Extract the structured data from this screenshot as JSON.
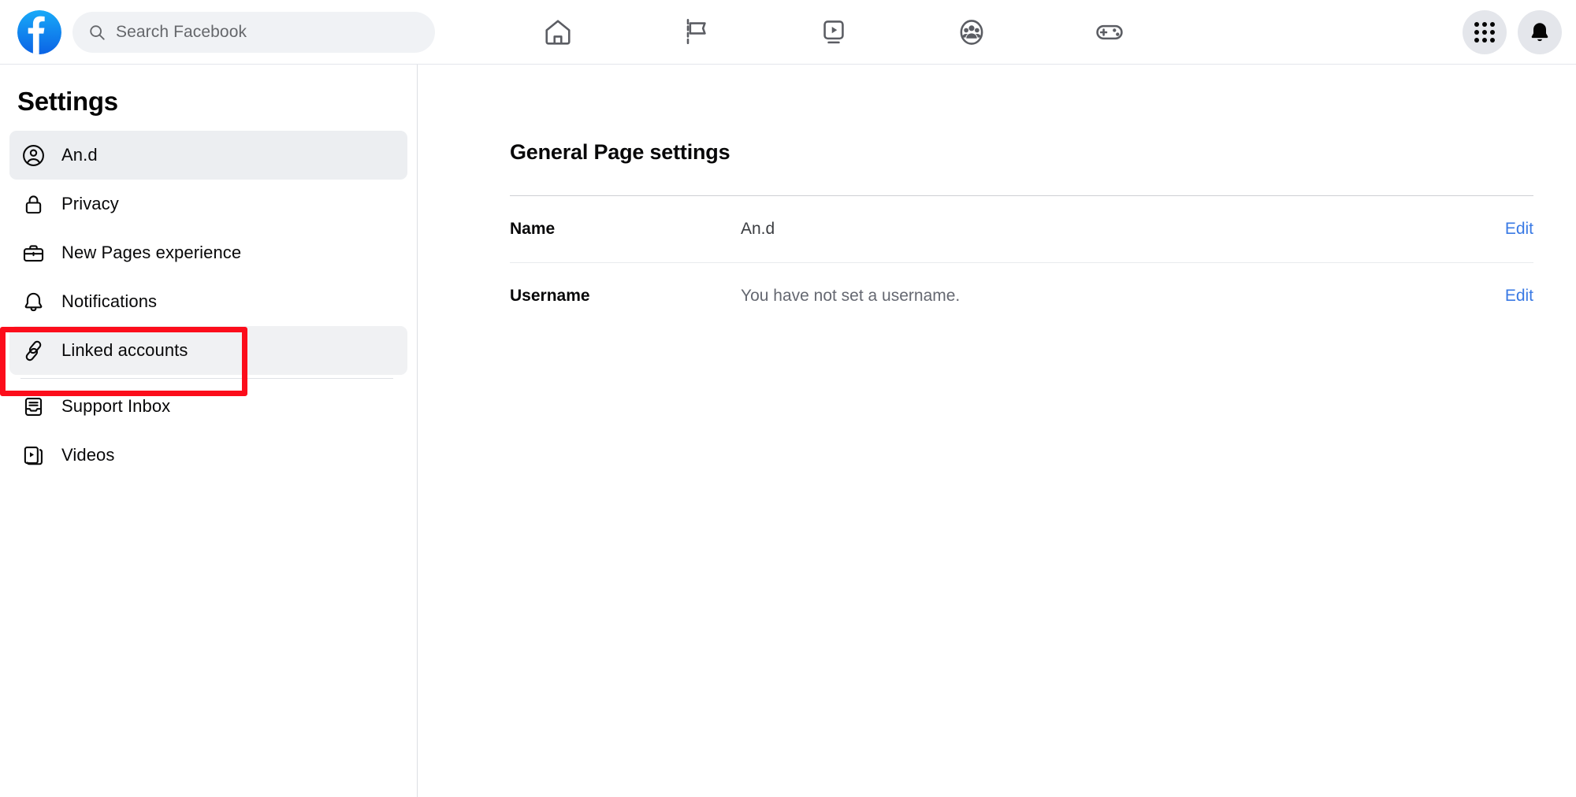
{
  "header": {
    "logo_icon": "facebook-logo",
    "search": {
      "placeholder": "Search Facebook",
      "value": "",
      "icon": "search-icon"
    },
    "nav_items": [
      {
        "name": "home",
        "icon": "home-icon"
      },
      {
        "name": "pages",
        "icon": "flag-icon"
      },
      {
        "name": "video",
        "icon": "video-play-icon"
      },
      {
        "name": "groups",
        "icon": "groups-icon"
      },
      {
        "name": "gaming",
        "icon": "gamepad-icon"
      }
    ],
    "right_items": [
      {
        "name": "menu",
        "icon": "grid-menu-icon"
      },
      {
        "name": "notifications",
        "icon": "bell-icon"
      }
    ]
  },
  "sidebar": {
    "title": "Settings",
    "items": [
      {
        "label": "An.d",
        "icon": "profile-circle-icon",
        "state": "active"
      },
      {
        "label": "Privacy",
        "icon": "lock-icon",
        "state": "normal"
      },
      {
        "label": "New Pages experience",
        "icon": "briefcase-icon",
        "state": "normal"
      },
      {
        "label": "Notifications",
        "icon": "bell-outline-icon",
        "state": "normal"
      },
      {
        "label": "Linked accounts",
        "icon": "chain-link-icon",
        "state": "hovered"
      },
      {
        "label": "Support Inbox",
        "icon": "inbox-icon",
        "state": "normal"
      },
      {
        "label": "Videos",
        "icon": "video-stack-icon",
        "state": "normal"
      }
    ]
  },
  "main": {
    "title": "General Page settings",
    "rows": [
      {
        "label": "Name",
        "value": "An.d",
        "value_style": "strong",
        "action": "Edit"
      },
      {
        "label": "Username",
        "value": "You have not set a username.",
        "value_style": "muted",
        "action": "Edit"
      }
    ]
  },
  "annotation": {
    "target": "Linked accounts",
    "color": "#fc0d1b"
  }
}
